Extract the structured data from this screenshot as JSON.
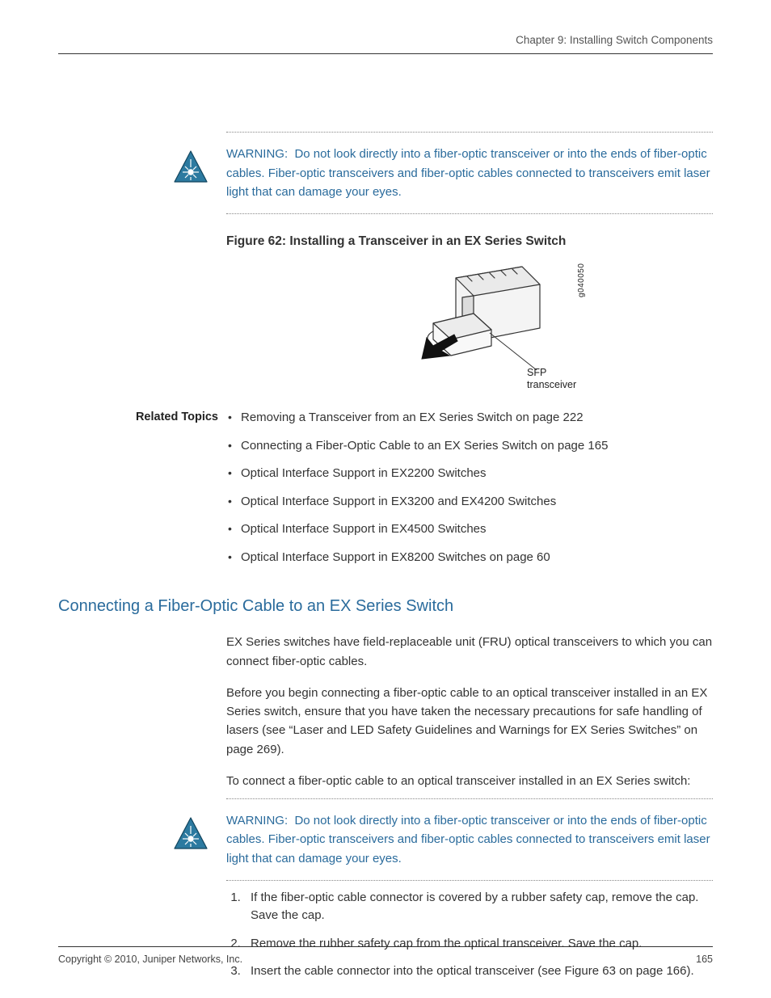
{
  "header": {
    "chapter": "Chapter 9: Installing Switch Components"
  },
  "warning1": {
    "label": "WARNING:",
    "text": "Do not look directly into a fiber-optic transceiver or into the ends of fiber-optic cables. Fiber-optic transceivers and fiber-optic cables connected to transceivers emit laser light that can damage your eyes."
  },
  "figure": {
    "caption": "Figure 62: Installing a Transceiver in an EX Series Switch",
    "callout_line1": "SFP",
    "callout_line2": "transceiver",
    "side_label": "g040050"
  },
  "related": {
    "label": "Related Topics",
    "items": [
      "Removing a Transceiver from an EX Series Switch on page 222",
      "Connecting a Fiber-Optic Cable to an EX Series Switch on page 165",
      "Optical Interface Support in EX2200 Switches",
      "Optical Interface Support in EX3200 and EX4200 Switches",
      "Optical Interface Support in EX4500 Switches",
      "Optical Interface Support in EX8200 Switches on page 60"
    ]
  },
  "section": {
    "heading": "Connecting a Fiber-Optic Cable to an EX Series Switch",
    "p1": "EX Series switches have field-replaceable unit (FRU) optical transceivers to which you can connect fiber-optic cables.",
    "p2": "Before you begin connecting a fiber-optic cable to an optical transceiver installed in an EX Series switch, ensure that you have taken the necessary precautions for safe handling of lasers (see “Laser and LED Safety Guidelines and Warnings for EX Series Switches” on page 269).",
    "p3": "To connect a fiber-optic cable to an optical transceiver installed in an EX Series switch:"
  },
  "warning2": {
    "label": "WARNING:",
    "text": "Do not look directly into a fiber-optic transceiver or into the ends of fiber-optic cables. Fiber-optic transceivers and fiber-optic cables connected to transceivers emit laser light that can damage your eyes."
  },
  "steps": [
    "If the fiber-optic cable connector is covered by a rubber safety cap, remove the cap. Save the cap.",
    "Remove the rubber safety cap from the optical transceiver. Save the cap.",
    "Insert the cable connector into the optical transceiver (see Figure 63 on page 166)."
  ],
  "footer": {
    "copyright": "Copyright © 2010, Juniper Networks, Inc.",
    "page": "165"
  }
}
